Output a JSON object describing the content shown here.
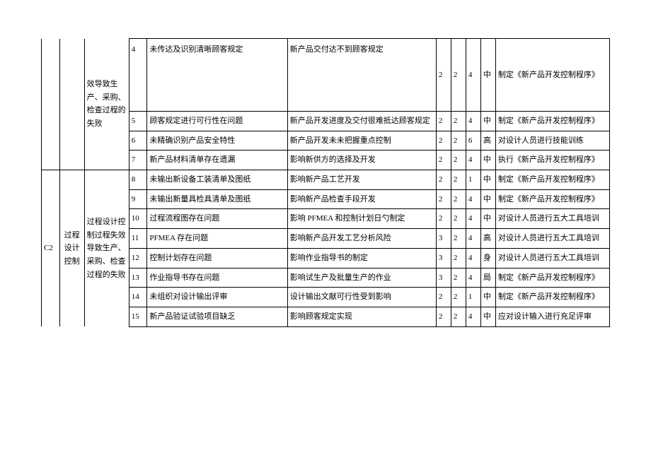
{
  "upper_group": {
    "col_c": "效导致生产、采购、检查过程的失败",
    "rows": [
      {
        "n": "4",
        "issue": "未传达及识别清晰顾客规定",
        "effect": "新产品交付达不到顾客规定",
        "v1": "2",
        "v2": "2",
        "v3": "4",
        "lvl": "中",
        "action": "制定《新产品开发控制程序》",
        "tall": true
      },
      {
        "n": "5",
        "issue": "顾客规定进行可行性在问题",
        "effect": "新产品开发进度及交付很难抵达顾客规定",
        "v1": "2",
        "v2": "2",
        "v3": "4",
        "lvl": "中",
        "action": "制定《新产品开发控制程序》"
      },
      {
        "n": "6",
        "issue": "未精确识别产品安全特性",
        "effect": "新产品开发未未把握重点控制",
        "v1": "2",
        "v2": "2",
        "v3": "6",
        "lvl": "高",
        "action": "对设计人员进行技能训练"
      },
      {
        "n": "7",
        "issue": "新产品材料清单存在遗漏",
        "effect": "影响新供方的选择及开发",
        "v1": "2",
        "v2": "2",
        "v3": "4",
        "lvl": "中",
        "action": "执行《新产品开发控制程序》"
      }
    ]
  },
  "lower_group": {
    "col_a": "C2",
    "col_b": "过程设计控制",
    "col_c": "过程设计控制过程失效导致生产、采购、检查过程的失败",
    "rows": [
      {
        "n": "8",
        "issue": "未输出新设备工装清单及图纸",
        "effect": "影响新产品工艺开发",
        "v1": "2",
        "v2": "2",
        "v3": "1",
        "lvl": "中",
        "action": "制定《新产品开发控制程序》"
      },
      {
        "n": "9",
        "issue": "未输出新量具检具清单及图纸",
        "effect": "影响新产品检查手段开发",
        "v1": "2",
        "v2": "2",
        "v3": "4",
        "lvl": "中",
        "action": "制定《新产品开发控制程序》"
      },
      {
        "n": "10",
        "issue": "过程流程图存在问题",
        "effect": "影响 PFMEA 和控制计划日勺制定",
        "v1": "2",
        "v2": "2",
        "v3": "4",
        "lvl": "中",
        "action": "对设计人员进行五大工具培训"
      },
      {
        "n": "11",
        "issue": "PFMEA 存在问题",
        "effect": "影响新产品开发工艺分析风险",
        "v1": "3",
        "v2": "2",
        "v3": "4",
        "lvl": "高",
        "action": "对设计人员进行五大工具培训"
      },
      {
        "n": "12",
        "issue": "控制计划存在问题",
        "effect": "影响作业指导书的制定",
        "v1": "3",
        "v2": "2",
        "v3": "4",
        "lvl": "身",
        "action": "对设计人员进行五大工具培训"
      },
      {
        "n": "13",
        "issue": "作业指导书存在问题",
        "effect": "影响试生产及批量生产的作业",
        "v1": "3",
        "v2": "2",
        "v3": "4",
        "lvl": "局",
        "action": "制定《新产品开发控制程序》"
      },
      {
        "n": "14",
        "issue": "未组织对设计输出评审",
        "effect": "设计输出文献可行性受到影响",
        "v1": "2",
        "v2": "2",
        "v3": "1",
        "lvl": "中",
        "action": "制定《新产品开发控制程序》"
      },
      {
        "n": "15",
        "issue": "新产品验证试验项目缺乏",
        "effect": "影响顾客规定实现",
        "v1": "2",
        "v2": "2",
        "v3": "4",
        "lvl": "中",
        "action": "应对设计输入进行充足评审"
      }
    ]
  }
}
